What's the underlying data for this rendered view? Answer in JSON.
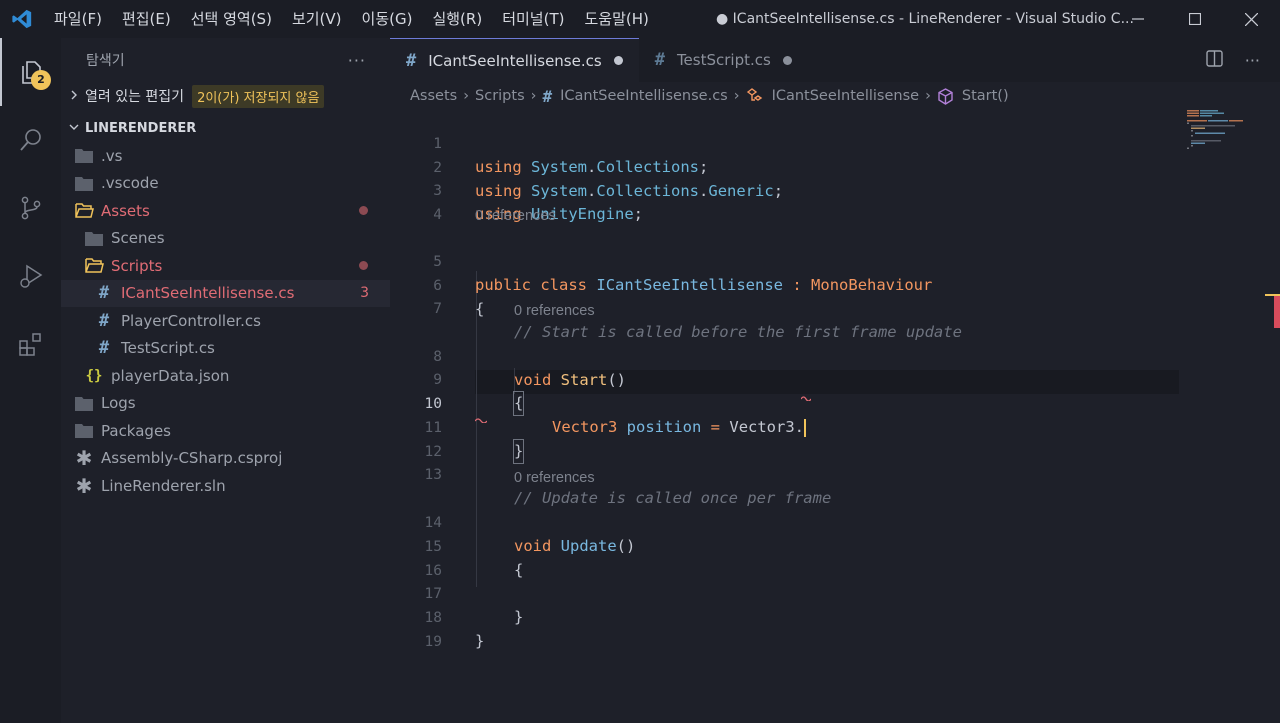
{
  "menu": [
    "파일(F)",
    "편집(E)",
    "선택 영역(S)",
    "보기(V)",
    "이동(G)",
    "실행(R)",
    "터미널(T)",
    "도움말(H)"
  ],
  "window_title": "● ICantSeeIntellisense.cs - LineRenderer - Visual Studio C...",
  "activity": {
    "explorer_badge": "2"
  },
  "sidebar": {
    "title": "탐색기",
    "open_editors": "열려 있는 편집기",
    "unsaved_badge": "2이(가) 저장되지 않음",
    "project": "LINERENDERER",
    "tree": [
      {
        "label": ".vs",
        "type": "folder"
      },
      {
        "label": ".vscode",
        "type": "folder"
      },
      {
        "label": "Assets",
        "type": "folder-open",
        "modified": true
      },
      {
        "label": "Scenes",
        "type": "folder"
      },
      {
        "label": "Scripts",
        "type": "folder-open",
        "modified": true
      },
      {
        "label": "ICantSeeIntellisense.cs",
        "type": "cs",
        "errors": "3"
      },
      {
        "label": "PlayerController.cs",
        "type": "cs"
      },
      {
        "label": "TestScript.cs",
        "type": "cs"
      },
      {
        "label": "playerData.json",
        "type": "json"
      },
      {
        "label": "Logs",
        "type": "folder"
      },
      {
        "label": "Packages",
        "type": "folder"
      },
      {
        "label": "Assembly-CSharp.csproj",
        "type": "proj"
      },
      {
        "label": "LineRenderer.sln",
        "type": "proj"
      }
    ]
  },
  "tabs": [
    {
      "label": "ICantSeeIntellisense.cs",
      "active": true,
      "dirty": true
    },
    {
      "label": "TestScript.cs",
      "active": false,
      "dirty": true
    }
  ],
  "breadcrumb": [
    "Assets",
    "Scripts",
    "ICantSeeIntellisense.cs",
    "ICantSeeIntellisense",
    "Start()"
  ],
  "code": {
    "line_numbers": [
      "1",
      "2",
      "3",
      "4",
      "5",
      "6",
      "7",
      "8",
      "9",
      "10",
      "11",
      "12",
      "13",
      "14",
      "15",
      "16",
      "17",
      "18",
      "19"
    ],
    "references_label": "0 references",
    "l1": {
      "kw": "using",
      "ns1": "System",
      "dot": ".",
      "ns2": "Collections",
      "semi": ";"
    },
    "l2": {
      "kw": "using",
      "ns1": "System",
      "dot1": ".",
      "ns2": "Collections",
      "dot2": ".",
      "ns3": "Generic",
      "semi": ";"
    },
    "l3": {
      "kw": "using",
      "ns1": "UnityEngine",
      "semi": ";"
    },
    "l5": {
      "kw1": "public",
      "kw2": "class",
      "name": "ICantSeeIntellisense",
      "colon": ":",
      "base": "MonoBehaviour"
    },
    "brace_open": "{",
    "brace_close": "}",
    "l7_comment": "// Start is called before the first frame update",
    "l8": {
      "kw": "void",
      "fn": "Start",
      "parens": "()"
    },
    "l10": {
      "type": "Vector3",
      "var": "position",
      "op": "=",
      "expr": "Vector3."
    },
    "l13_comment": "// Update is called once per frame",
    "l14": {
      "kw": "void",
      "fn": "Update",
      "parens": "()"
    }
  },
  "colors": {
    "accent": "#f0c35a",
    "error": "#e06c75",
    "keyword": "#f39660",
    "identifier": "#79b8e0"
  }
}
